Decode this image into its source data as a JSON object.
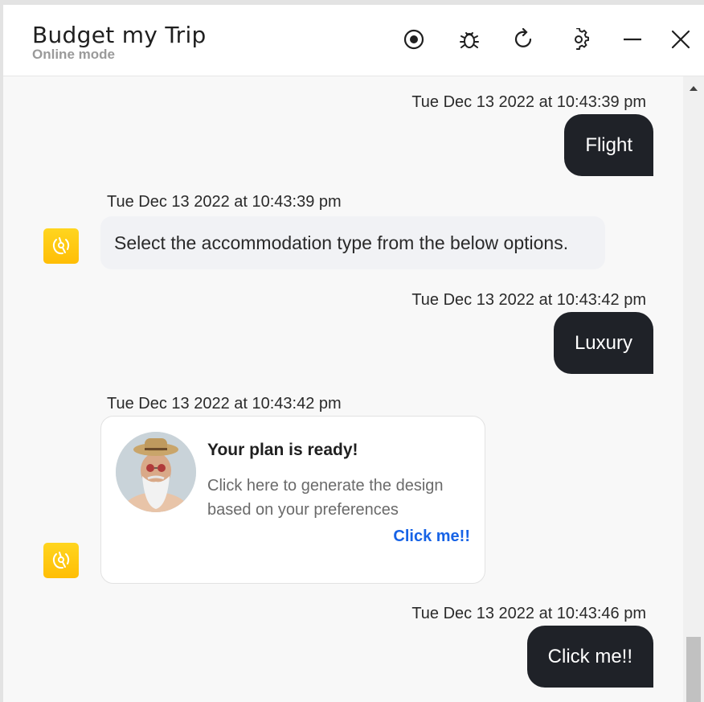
{
  "header": {
    "title": "Budget my Trip",
    "subtitle": "Online mode",
    "icons": [
      "record-icon",
      "bug-icon",
      "refresh-icon",
      "settings-icon",
      "minimize-icon",
      "close-icon"
    ]
  },
  "messages": [
    {
      "sender": "user",
      "timestamp": "Tue Dec 13 2022 at 10:43:39 pm",
      "text": "Flight"
    },
    {
      "sender": "bot",
      "timestamp": "Tue Dec 13 2022 at 10:43:39 pm",
      "text": "Select the accommodation type from the below options."
    },
    {
      "sender": "user",
      "timestamp": "Tue Dec 13 2022 at 10:43:42 pm",
      "text": "Luxury"
    },
    {
      "sender": "bot",
      "timestamp": "Tue Dec 13 2022 at 10:43:42 pm",
      "card": {
        "title": "Your plan is ready!",
        "description": "Click here to generate the design based on your preferences",
        "link": "Click me!!"
      }
    },
    {
      "sender": "user",
      "timestamp": "Tue Dec 13 2022 at 10:43:46 pm",
      "text": "Click me!!"
    }
  ],
  "colors": {
    "user_bubble": "#1f2228",
    "bot_bubble": "#f1f2f5",
    "avatar": "#ffc60f",
    "link": "#1763e6"
  }
}
